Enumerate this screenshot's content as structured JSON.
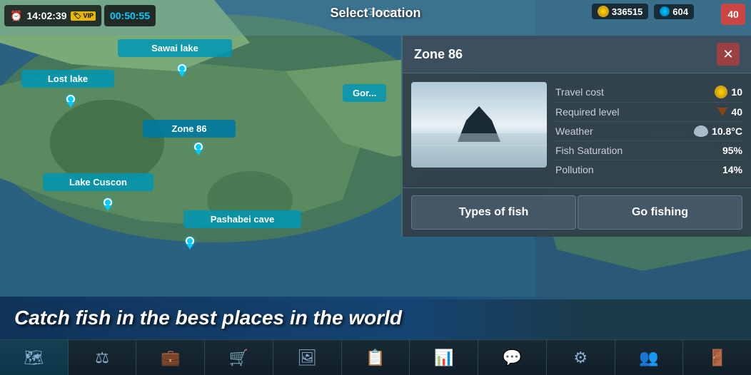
{
  "topBar": {
    "time": "14:02:39",
    "vip_label": "VIP",
    "timer": "00:50:55",
    "glacier_label": "Glacier",
    "select_location": "Select location",
    "currency1_value": "336515",
    "currency2_value": "604",
    "level": "40"
  },
  "locations": [
    {
      "name": "Sawai lake",
      "top": "55",
      "left": "185"
    },
    {
      "name": "Lost lake",
      "top": "98",
      "left": "45"
    },
    {
      "name": "Zone 86",
      "top": "168",
      "left": "210"
    },
    {
      "name": "Lake Cuscon",
      "top": "243",
      "left": "80"
    },
    {
      "name": "Pashabei cave",
      "top": "295",
      "left": "280"
    }
  ],
  "zonePanel": {
    "title": "Zone 86",
    "close_label": "✕",
    "travel_cost_label": "Travel cost",
    "travel_cost_value": "10",
    "required_level_label": "Required level",
    "required_level_value": "40",
    "weather_label": "Weather",
    "weather_value": "10.8°C",
    "fish_saturation_label": "Fish Saturation",
    "fish_saturation_value": "95%",
    "pollution_label": "Pollution",
    "pollution_value": "14%",
    "btn_types_of_fish": "Types of fish",
    "btn_go_fishing": "Go fishing"
  },
  "banner": {
    "text": "Catch fish in the best places in the world"
  },
  "bottomNav": {
    "items": [
      {
        "icon": "🗺",
        "label": "map"
      },
      {
        "icon": "⚖",
        "label": "balance"
      },
      {
        "icon": "💼",
        "label": "inventory"
      },
      {
        "icon": "🛒",
        "label": "shop"
      },
      {
        "icon": "🖼",
        "label": "gallery"
      },
      {
        "icon": "📋",
        "label": "quests"
      },
      {
        "icon": "📊",
        "label": "stats"
      },
      {
        "icon": "💬",
        "label": "chat"
      },
      {
        "icon": "⚙",
        "label": "settings"
      },
      {
        "icon": "👥",
        "label": "friends"
      },
      {
        "icon": "🚪",
        "label": "exit"
      }
    ]
  },
  "gorge_label": "Gor..."
}
